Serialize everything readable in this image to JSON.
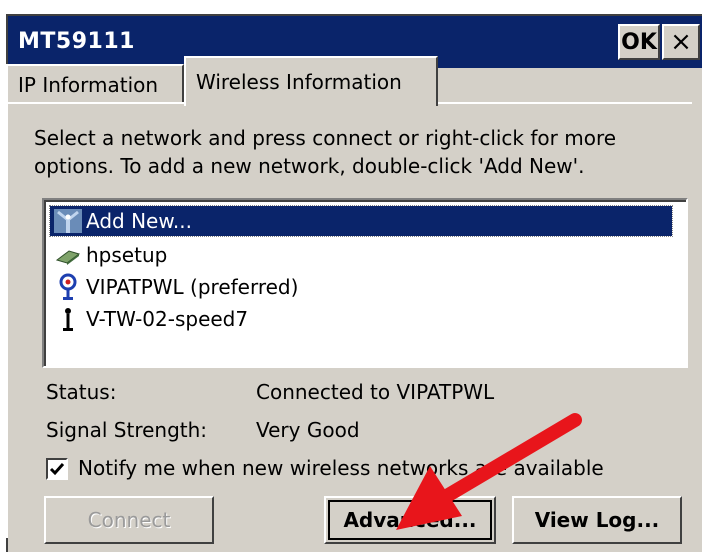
{
  "window": {
    "title": "MT59111"
  },
  "titlebar": {
    "ok_label": "OK",
    "close_label": "×"
  },
  "tabs": [
    {
      "label": "IP Information",
      "active": false
    },
    {
      "label": "Wireless Information",
      "active": true
    }
  ],
  "instructions": "Select a network and press connect or right-click for more options.  To add a new network, double-click 'Add New'.",
  "networks": [
    {
      "label": "Add New...",
      "icon": "antenna-icon",
      "selected": true
    },
    {
      "label": "hpsetup",
      "icon": "adhoc-network-icon",
      "selected": false
    },
    {
      "label": "VIPATPWL (preferred)",
      "icon": "preferred-network-icon",
      "selected": false
    },
    {
      "label": "V-TW-02-speed7",
      "icon": "network-icon",
      "selected": false
    }
  ],
  "status": {
    "label": "Status:",
    "value": "Connected to VIPATPWL"
  },
  "signal": {
    "label": "Signal Strength:",
    "value": "Very Good"
  },
  "notify": {
    "label": "Notify me when new wireless networks are available",
    "checked": true
  },
  "buttons": {
    "connect": "Connect",
    "advanced": "Advanced...",
    "view_log": "View Log..."
  },
  "colors": {
    "titlebar": "#0a246a",
    "selection": "#0a246a",
    "face": "#d4d0c8",
    "annotation_arrow": "#e8151b"
  }
}
